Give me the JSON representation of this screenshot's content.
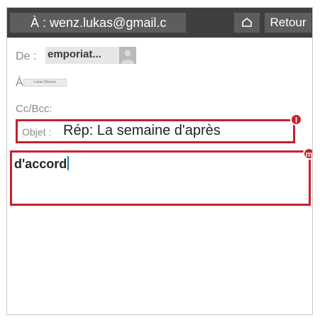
{
  "header": {
    "to_address": "À : wenz.lukas@gmail.c",
    "home_icon": "home-icon",
    "back_label": "Retour"
  },
  "from": {
    "label": "De :",
    "sender_name": "emporiat...",
    "avatar_icon": "avatar-placeholder"
  },
  "to": {
    "label": "À",
    "recipient_chip": "Lukas Wenner"
  },
  "cc": {
    "label": "Cc/Bcc:"
  },
  "subject": {
    "label": "Objet :",
    "value": "Rép: La semaine d'après"
  },
  "body": {
    "text": "d'accord"
  },
  "callouts": {
    "subject_marker": "l",
    "body_marker": "m",
    "color": "#c8202e"
  },
  "colors": {
    "topbar": "#3f3f3f",
    "chip": "#5d5d5d",
    "caret": "#1e7ea8"
  }
}
